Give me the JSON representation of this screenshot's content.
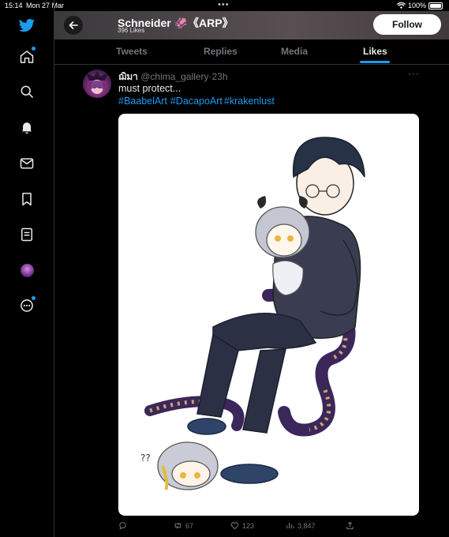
{
  "status_bar": {
    "time": "15:14",
    "date": "Mon 27 Mar",
    "battery": "100%"
  },
  "sidebar": {
    "items": [
      {
        "name": "twitter-logo"
      },
      {
        "name": "home"
      },
      {
        "name": "explore"
      },
      {
        "name": "notifications"
      },
      {
        "name": "messages"
      },
      {
        "name": "bookmarks"
      },
      {
        "name": "lists"
      },
      {
        "name": "profile"
      },
      {
        "name": "more"
      }
    ]
  },
  "header": {
    "name": "Schneider 🦑《ARP》",
    "subtitle": "396 Likes",
    "follow_label": "Follow"
  },
  "tabs": [
    {
      "label": "Tweets"
    },
    {
      "label": "Replies"
    },
    {
      "label": "Media"
    },
    {
      "label": "Likes",
      "active": true
    }
  ],
  "tweet": {
    "author_name": "ฌิมา",
    "handle": "@chima_gallery",
    "time": "23h",
    "text": "must protect...",
    "hashtags": [
      "#BaabelArt",
      "#DacapoArt",
      "#krakenlust"
    ],
    "media_text": "?\n?",
    "actions": {
      "reply": "",
      "retweet": "67",
      "like": "123",
      "views": "3,847",
      "share": ""
    }
  },
  "colors": {
    "accent": "#1d9bf0",
    "background": "#000000",
    "muted": "#71767b"
  }
}
